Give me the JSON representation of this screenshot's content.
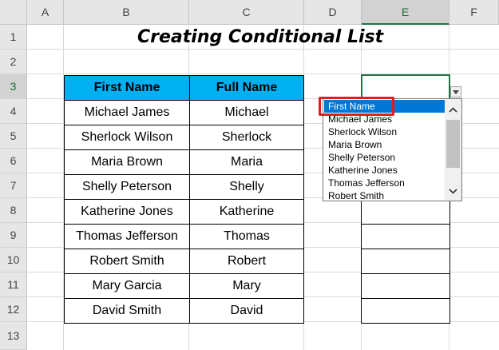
{
  "columns": [
    "A",
    "B",
    "C",
    "D",
    "E",
    "F"
  ],
  "rows": [
    "1",
    "2",
    "3",
    "4",
    "5",
    "6",
    "7",
    "8",
    "9",
    "10",
    "11",
    "12",
    "13"
  ],
  "title": "Creating Conditional List",
  "table": {
    "headers": [
      "First Name",
      "Full Name"
    ],
    "rows": [
      [
        "Michael James",
        "Michael"
      ],
      [
        "Sherlock Wilson",
        "Sherlock"
      ],
      [
        "Maria Brown",
        "Maria"
      ],
      [
        "Shelly Peterson",
        "Shelly"
      ],
      [
        "Katherine Jones",
        "Katherine"
      ],
      [
        "Thomas Jefferson",
        "Thomas"
      ],
      [
        "Robert Smith",
        "Robert"
      ],
      [
        "Mary Garcia",
        "Mary"
      ],
      [
        "David Smith",
        "David"
      ]
    ]
  },
  "active_cell": "E3",
  "dropdown": {
    "items": [
      "First Name",
      "Michael James",
      "Sherlock Wilson",
      "Maria Brown",
      "Shelly Peterson",
      "Katherine Jones",
      "Thomas Jefferson",
      "Robert Smith"
    ],
    "selected": "First Name"
  },
  "colors": {
    "header_fill": "#00b0f0",
    "active_border": "#217346",
    "selection": "#0078d7",
    "highlight": "#e31b23"
  }
}
